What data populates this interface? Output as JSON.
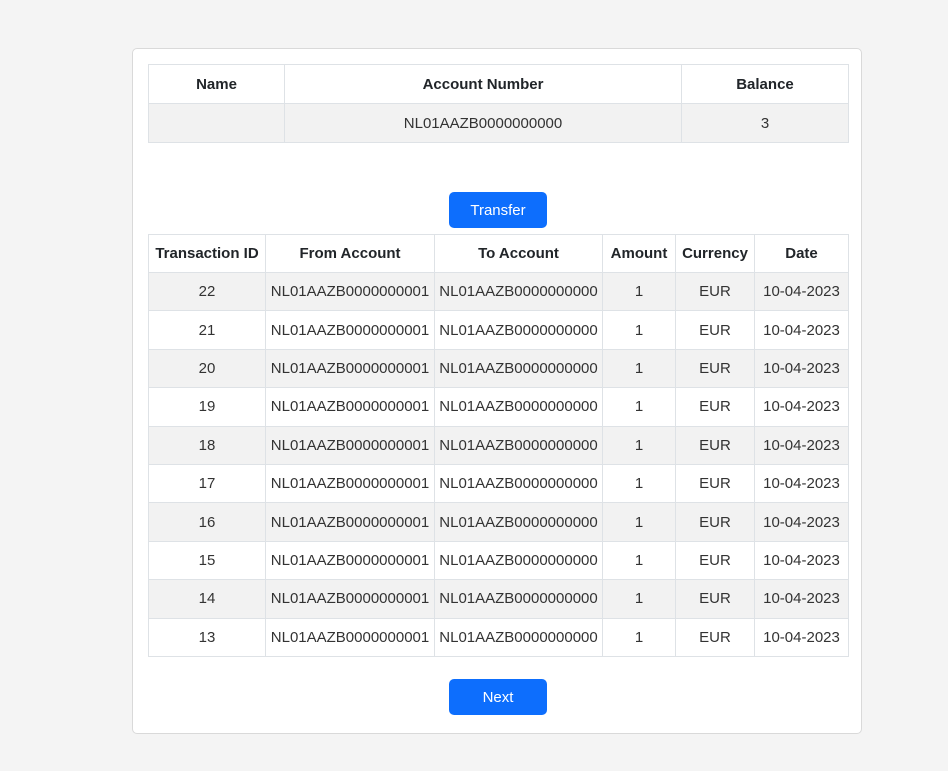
{
  "account_table": {
    "headers": [
      "Name",
      "Account Number",
      "Balance"
    ],
    "row": {
      "name": "",
      "account_number": "NL01AAZB0000000000",
      "balance": "3"
    }
  },
  "buttons": {
    "transfer_label": "Transfer",
    "next_label": "Next"
  },
  "transactions": {
    "headers": [
      "Transaction ID",
      "From Account",
      "To Account",
      "Amount",
      "Currency",
      "Date"
    ],
    "rows": [
      {
        "id": "22",
        "from": "NL01AAZB0000000001",
        "to": "NL01AAZB0000000000",
        "amount": "1",
        "currency": "EUR",
        "date": "10-04-2023"
      },
      {
        "id": "21",
        "from": "NL01AAZB0000000001",
        "to": "NL01AAZB0000000000",
        "amount": "1",
        "currency": "EUR",
        "date": "10-04-2023"
      },
      {
        "id": "20",
        "from": "NL01AAZB0000000001",
        "to": "NL01AAZB0000000000",
        "amount": "1",
        "currency": "EUR",
        "date": "10-04-2023"
      },
      {
        "id": "19",
        "from": "NL01AAZB0000000001",
        "to": "NL01AAZB0000000000",
        "amount": "1",
        "currency": "EUR",
        "date": "10-04-2023"
      },
      {
        "id": "18",
        "from": "NL01AAZB0000000001",
        "to": "NL01AAZB0000000000",
        "amount": "1",
        "currency": "EUR",
        "date": "10-04-2023"
      },
      {
        "id": "17",
        "from": "NL01AAZB0000000001",
        "to": "NL01AAZB0000000000",
        "amount": "1",
        "currency": "EUR",
        "date": "10-04-2023"
      },
      {
        "id": "16",
        "from": "NL01AAZB0000000001",
        "to": "NL01AAZB0000000000",
        "amount": "1",
        "currency": "EUR",
        "date": "10-04-2023"
      },
      {
        "id": "15",
        "from": "NL01AAZB0000000001",
        "to": "NL01AAZB0000000000",
        "amount": "1",
        "currency": "EUR",
        "date": "10-04-2023"
      },
      {
        "id": "14",
        "from": "NL01AAZB0000000001",
        "to": "NL01AAZB0000000000",
        "amount": "1",
        "currency": "EUR",
        "date": "10-04-2023"
      },
      {
        "id": "13",
        "from": "NL01AAZB0000000001",
        "to": "NL01AAZB0000000000",
        "amount": "1",
        "currency": "EUR",
        "date": "10-04-2023"
      }
    ]
  },
  "colors": {
    "accent": "#0d6efd",
    "striped_row": "#f2f2f2",
    "page_background": "#f4f4f4"
  }
}
